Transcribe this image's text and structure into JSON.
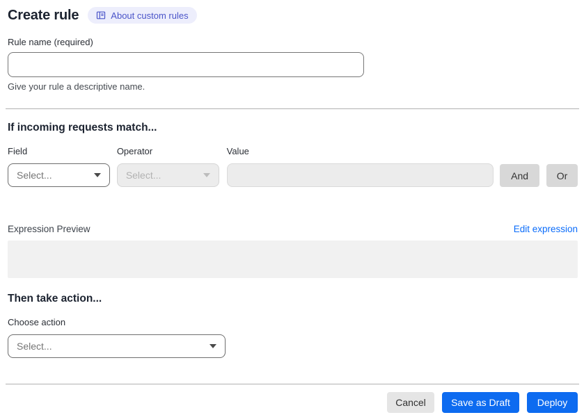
{
  "header": {
    "title": "Create rule",
    "about_badge": {
      "label": "About custom rules",
      "icon": "book-icon"
    }
  },
  "rule_name": {
    "label": "Rule name (required)",
    "value": "",
    "helper": "Give your rule a descriptive name."
  },
  "match_section": {
    "heading": "If incoming requests match...",
    "field": {
      "label": "Field",
      "selected": "Select...",
      "enabled": true
    },
    "operator": {
      "label": "Operator",
      "selected": "Select...",
      "enabled": false
    },
    "value": {
      "label": "Value",
      "value": "",
      "enabled": false
    },
    "and_button": "And",
    "or_button": "Or",
    "expression_preview": {
      "label": "Expression Preview",
      "edit_link": "Edit expression",
      "content": ""
    }
  },
  "action_section": {
    "heading": "Then take action...",
    "choose_action": {
      "label": "Choose action",
      "selected": "Select..."
    }
  },
  "footer": {
    "cancel": "Cancel",
    "save_draft": "Save as Draft",
    "deploy": "Deploy"
  },
  "colors": {
    "primary_blue": "#0d6bf0",
    "link_blue": "#0b6cfa",
    "badge_bg": "#edeefc",
    "badge_text": "#4a54c9",
    "disabled_bg": "#ececec",
    "preview_bg": "#f1f1f1",
    "joiner_gray": "#d8d8d8",
    "cancel_gray": "#e5e5e5",
    "divider_gray": "#b1b1b1"
  }
}
